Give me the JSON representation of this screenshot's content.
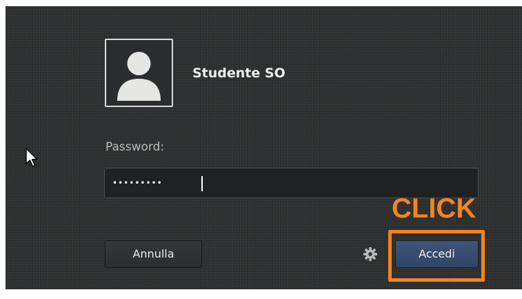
{
  "user": {
    "name": "Studente SO",
    "avatar_icon": "user-silhouette-icon"
  },
  "password": {
    "label": "Password:",
    "value": "•••••••••"
  },
  "buttons": {
    "cancel_label": "Annulla",
    "login_label": "Accedi",
    "settings_icon": "gear-icon"
  },
  "annotation": {
    "text": "CLICK",
    "color": "#f5841f"
  },
  "colors": {
    "background": "#2e3031",
    "login_button": "#3a5272",
    "text": "#eeeeec"
  }
}
